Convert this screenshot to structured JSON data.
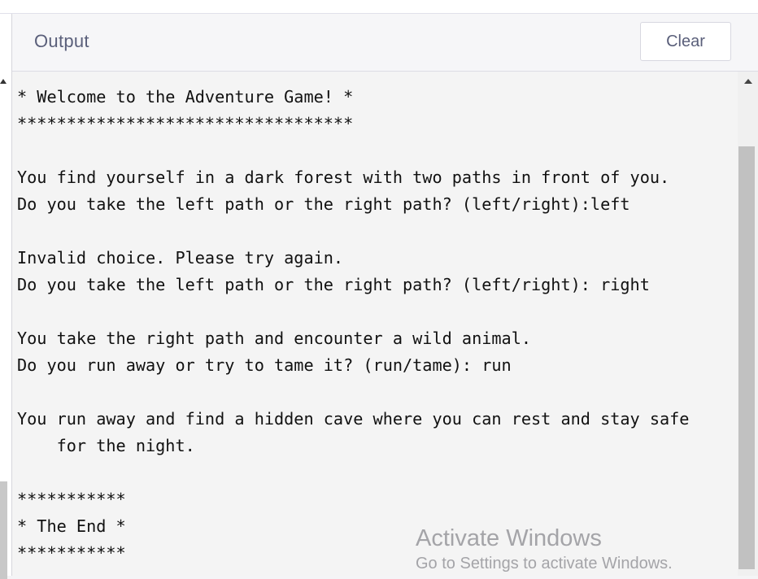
{
  "panel": {
    "title": "Output",
    "clear_label": "Clear"
  },
  "console": {
    "lines": [
      "* Welcome to the Adventure Game! *",
      "**********************************",
      "",
      "You find yourself in a dark forest with two paths in front of you.",
      "Do you take the left path or the right path? (left/right):left",
      "",
      "Invalid choice. Please try again.",
      "Do you take the left path or the right path? (left/right): right",
      "",
      "You take the right path and encounter a wild animal.",
      "Do you run away or try to tame it? (run/tame): run",
      "",
      "You run away and find a hidden cave where you can rest and stay safe",
      "    for the night.",
      "",
      "***********",
      "* The End *",
      "***********"
    ]
  },
  "watermark": {
    "title": "Activate Windows",
    "subtitle": "Go to Settings to activate Windows."
  }
}
